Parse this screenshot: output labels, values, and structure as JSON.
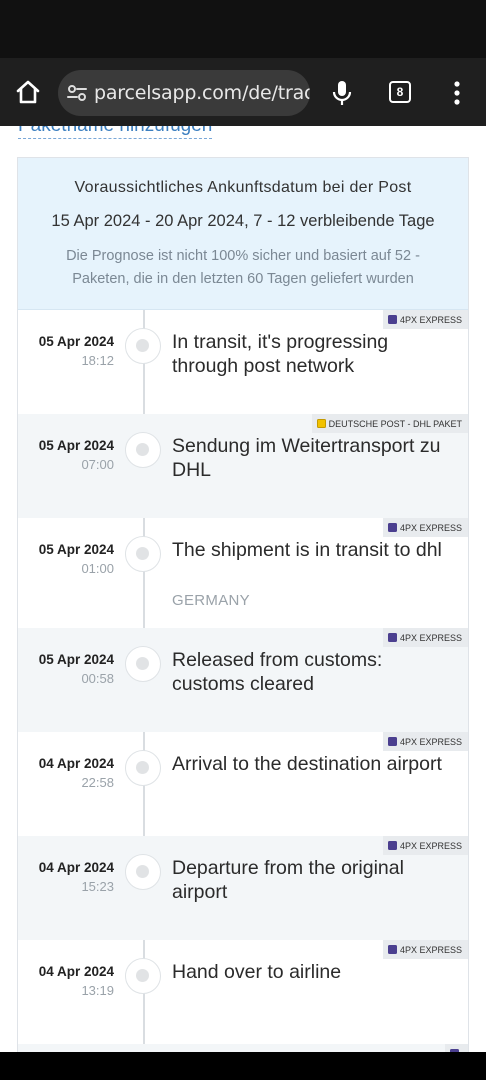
{
  "browser": {
    "url": "parcelsapp.com/de/tracl",
    "tab_count": "8",
    "colors": {
      "toolbar": "#1f1f1f",
      "urlbar": "#3a3a3a"
    }
  },
  "page": {
    "rename_link": "Paketname hinzufügen",
    "eta": {
      "title": "Voraussichtliches Ankunftsdatum bei der Post",
      "range": "15 Apr 2024 - 20 Apr 2024, 7 - 12 verbleibende Tage",
      "note": "Die Prognose ist nicht 100% sicher und basiert auf 52 - Paketen, die in den letzten 60 Tagen geliefert wurden"
    },
    "events": [
      {
        "date": "05 Apr 2024",
        "time": "18:12",
        "title": "In transit, it's progressing through post network",
        "location": "",
        "carrier": "4PX EXPRESS",
        "carrier_icon": "4px-logo-icon"
      },
      {
        "date": "05 Apr 2024",
        "time": "07:00",
        "title": "Sendung im Weitertransport zu DHL",
        "location": "",
        "carrier": "DEUTSCHE POST - DHL PAKET",
        "carrier_icon": "deutsche-post-logo-icon"
      },
      {
        "date": "05 Apr 2024",
        "time": "01:00",
        "title": "The shipment is in transit to dhl",
        "location": "GERMANY",
        "carrier": "4PX EXPRESS",
        "carrier_icon": "4px-logo-icon"
      },
      {
        "date": "05 Apr 2024",
        "time": "00:58",
        "title": "Released from customs: customs cleared",
        "location": "",
        "carrier": "4PX EXPRESS",
        "carrier_icon": "4px-logo-icon"
      },
      {
        "date": "04 Apr 2024",
        "time": "22:58",
        "title": "Arrival to the destination airport",
        "location": "",
        "carrier": "4PX EXPRESS",
        "carrier_icon": "4px-logo-icon"
      },
      {
        "date": "04 Apr 2024",
        "time": "15:23",
        "title": "Departure from the original airport",
        "location": "",
        "carrier": "4PX EXPRESS",
        "carrier_icon": "4px-logo-icon"
      },
      {
        "date": "04 Apr 2024",
        "time": "13:19",
        "title": "Hand over to airline",
        "location": "",
        "carrier": "4PX EXPRESS",
        "carrier_icon": "4px-logo-icon"
      }
    ]
  }
}
